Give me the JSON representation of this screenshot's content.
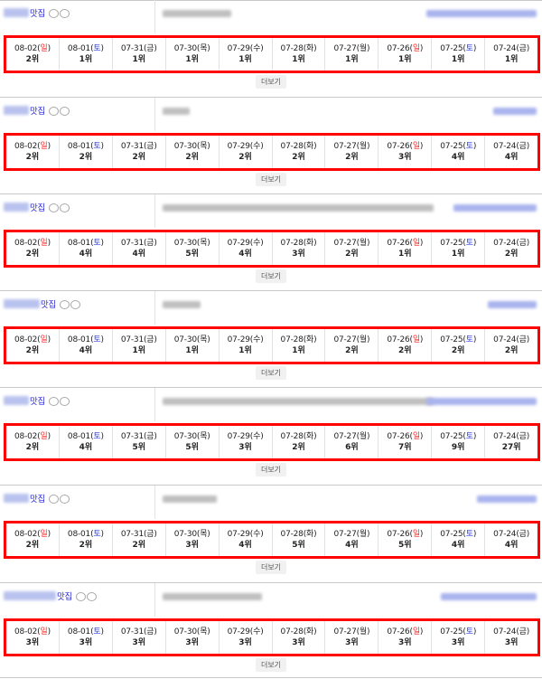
{
  "colors": {
    "highlight_border": "#ff0000",
    "sunday": "#ff2a2a",
    "saturday": "#2c3fe0",
    "keyword": "#2b2bd6"
  },
  "more_label": "더보기",
  "days": [
    {
      "date": "08-02",
      "weekday": "일"
    },
    {
      "date": "08-01",
      "weekday": "토"
    },
    {
      "date": "07-31",
      "weekday": "금"
    },
    {
      "date": "07-30",
      "weekday": "목"
    },
    {
      "date": "07-29",
      "weekday": "수"
    },
    {
      "date": "07-28",
      "weekday": "화"
    },
    {
      "date": "07-27",
      "weekday": "월"
    },
    {
      "date": "07-26",
      "weekday": "일"
    },
    {
      "date": "07-25",
      "weekday": "토"
    },
    {
      "date": "07-24",
      "weekday": "금"
    }
  ],
  "keywords": [
    {
      "suffix": "맛집",
      "ranks": [
        "2위",
        "1위",
        "1위",
        "1위",
        "1위",
        "1위",
        "1위",
        "1위",
        "1위",
        "1위"
      ]
    },
    {
      "suffix": "맛집",
      "ranks": [
        "2위",
        "2위",
        "2위",
        "2위",
        "2위",
        "2위",
        "2위",
        "3위",
        "4위",
        "4위"
      ]
    },
    {
      "suffix": "맛집",
      "ranks": [
        "2위",
        "4위",
        "4위",
        "5위",
        "4위",
        "3위",
        "2위",
        "1위",
        "1위",
        "2위"
      ]
    },
    {
      "suffix": "맛집",
      "ranks": [
        "2위",
        "4위",
        "1위",
        "1위",
        "1위",
        "1위",
        "2위",
        "2위",
        "2위",
        "2위"
      ]
    },
    {
      "suffix": "맛집",
      "ranks": [
        "2위",
        "4위",
        "5위",
        "5위",
        "3위",
        "2위",
        "6위",
        "7위",
        "9위",
        "27위"
      ]
    },
    {
      "suffix": "맛집",
      "ranks": [
        "2위",
        "2위",
        "2위",
        "3위",
        "4위",
        "5위",
        "4위",
        "5위",
        "4위",
        "4위"
      ]
    },
    {
      "suffix": "맛집",
      "ranks": [
        "3위",
        "3위",
        "3위",
        "3위",
        "3위",
        "3위",
        "3위",
        "3위",
        "3위",
        "3위"
      ]
    }
  ]
}
